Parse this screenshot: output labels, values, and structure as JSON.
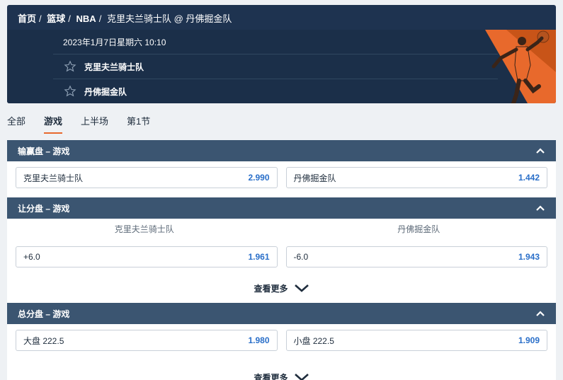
{
  "breadcrumb": {
    "home": "首页",
    "sport": "篮球",
    "league": "NBA",
    "event": "克里夫兰骑士队 @ 丹佛掘金队"
  },
  "event": {
    "datetime": "2023年1月7日星期六 10:10",
    "home_team": "克里夫兰骑士队",
    "away_team": "丹佛掘金队"
  },
  "tabs": [
    {
      "label": "全部",
      "active": false
    },
    {
      "label": "游戏",
      "active": true
    },
    {
      "label": "上半场",
      "active": false
    },
    {
      "label": "第1节",
      "active": false
    }
  ],
  "markets": {
    "moneyline": {
      "title": "输赢盘 – 游戏",
      "outcomes": [
        {
          "selection": "克里夫兰骑士队",
          "price": "2.990"
        },
        {
          "selection": "丹佛掘金队",
          "price": "1.442"
        }
      ]
    },
    "spread": {
      "title": "让分盘 – 游戏",
      "col_left": "克里夫兰骑士队",
      "col_right": "丹佛掘金队",
      "outcomes": [
        {
          "selection": "+6.0",
          "price": "1.961"
        },
        {
          "selection": "-6.0",
          "price": "1.943"
        }
      ],
      "more_label": "查看更多"
    },
    "total": {
      "title": "总分盘 – 游戏",
      "outcomes": [
        {
          "selection": "大盘 222.5",
          "price": "1.980"
        },
        {
          "selection": "小盘 222.5",
          "price": "1.909"
        }
      ],
      "more_label": "查看更多"
    }
  },
  "colors": {
    "header_bg": "#1e3350",
    "market_head_bg": "#3b5571",
    "accent": "#e8692c",
    "price": "#2a6fc9"
  },
  "icons": {
    "favorite": "star-icon",
    "collapse": "chevron-up-icon",
    "expand": "chevron-down-icon"
  }
}
